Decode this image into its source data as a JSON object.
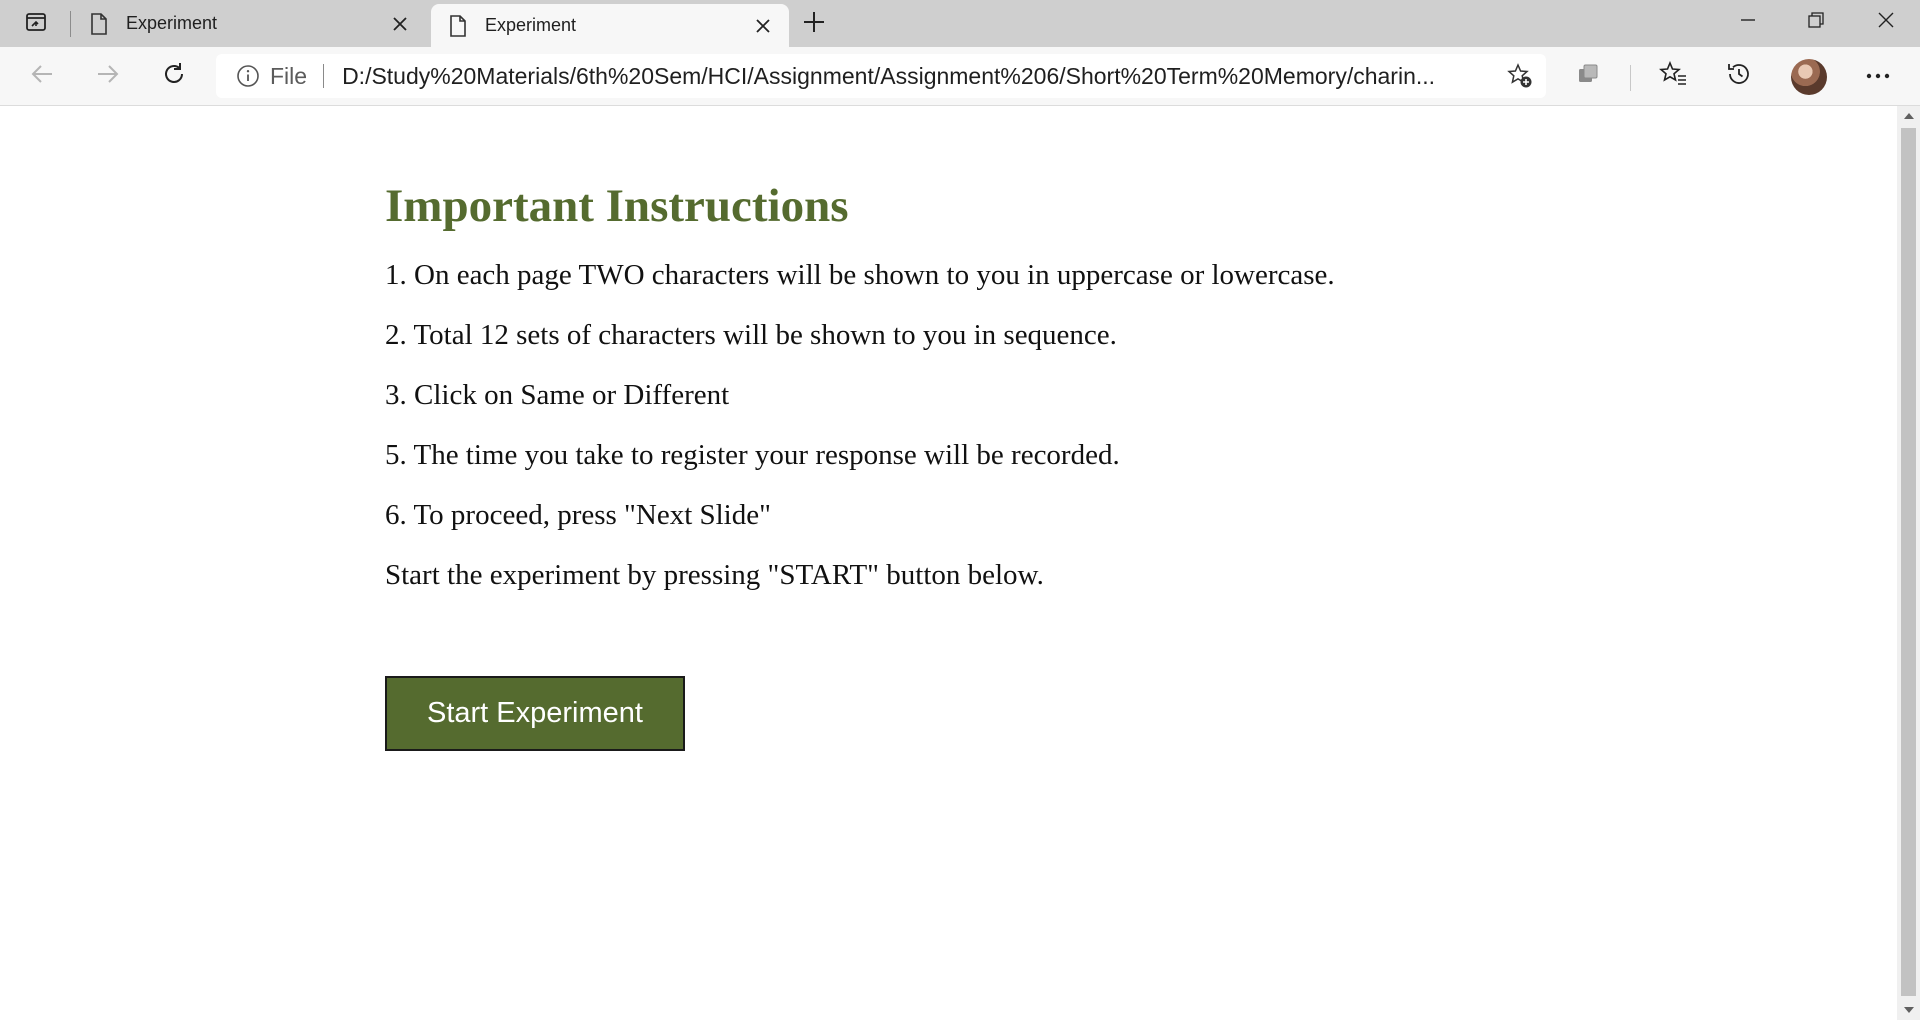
{
  "browser": {
    "tabs": [
      {
        "title": "Experiment",
        "active": false
      },
      {
        "title": "Experiment",
        "active": true
      }
    ],
    "address_prefix": "File",
    "url": "D:/Study%20Materials/6th%20Sem/HCI/Assignment/Assignment%206/Short%20Term%20Memory/charin..."
  },
  "page": {
    "heading": "Important Instructions",
    "instructions": [
      "1. On each page TWO characters will be shown to you in uppercase or lowercase.",
      "2. Total 12 sets of characters will be shown to you in sequence.",
      "3. Click on Same or Different",
      "5. The time you take to register your response will be recorded.",
      "6. To proceed, press \"Next Slide\""
    ],
    "start_note": "Start the experiment by pressing \"START\" button below.",
    "start_button": "Start Experiment"
  },
  "colors": {
    "accent": "#556b2f",
    "tabstrip": "#cfcfcf",
    "toolbar": "#f7f7f7"
  }
}
